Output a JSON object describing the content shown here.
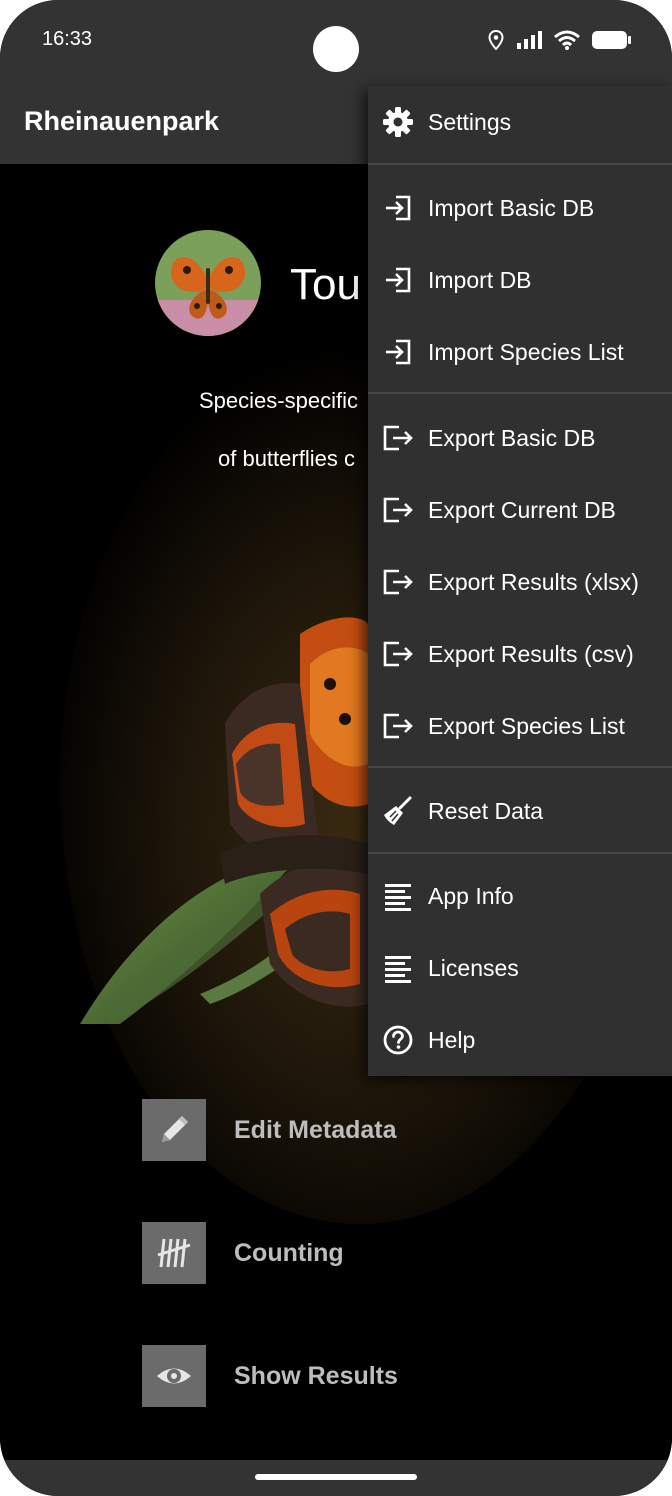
{
  "status_bar": {
    "time": "16:33"
  },
  "app_bar": {
    "title": "Rheinauenpark"
  },
  "main": {
    "app_name": "Tou",
    "subtitle_line1": "Species-specific",
    "subtitle_line2": "of butterflies c",
    "actions": [
      {
        "label": "Edit Metadata",
        "icon": "pencil-icon"
      },
      {
        "label": "Counting",
        "icon": "tally-icon"
      },
      {
        "label": "Show Results",
        "icon": "eye-icon"
      }
    ]
  },
  "menu": {
    "items": [
      {
        "label": "Settings",
        "icon": "gear-icon"
      },
      {
        "label": "Import Basic DB",
        "icon": "import-icon"
      },
      {
        "label": "Import DB",
        "icon": "import-icon"
      },
      {
        "label": "Import Species List",
        "icon": "import-icon"
      },
      {
        "label": "Export Basic DB",
        "icon": "export-icon"
      },
      {
        "label": "Export Current DB",
        "icon": "export-icon"
      },
      {
        "label": "Export Results (xlsx)",
        "icon": "export-icon"
      },
      {
        "label": "Export Results (csv)",
        "icon": "export-icon"
      },
      {
        "label": "Export Species List",
        "icon": "export-icon"
      },
      {
        "label": "Reset Data",
        "icon": "broom-icon"
      },
      {
        "label": "App Info",
        "icon": "text-lines-icon"
      },
      {
        "label": "Licenses",
        "icon": "text-lines-icon"
      },
      {
        "label": "Help",
        "icon": "help-circle-icon"
      }
    ]
  },
  "colors": {
    "bar": "#333333",
    "menu_bg": "#303030",
    "action_icon_bg": "#6b6b6b",
    "action_label": "#bdbdbd"
  }
}
